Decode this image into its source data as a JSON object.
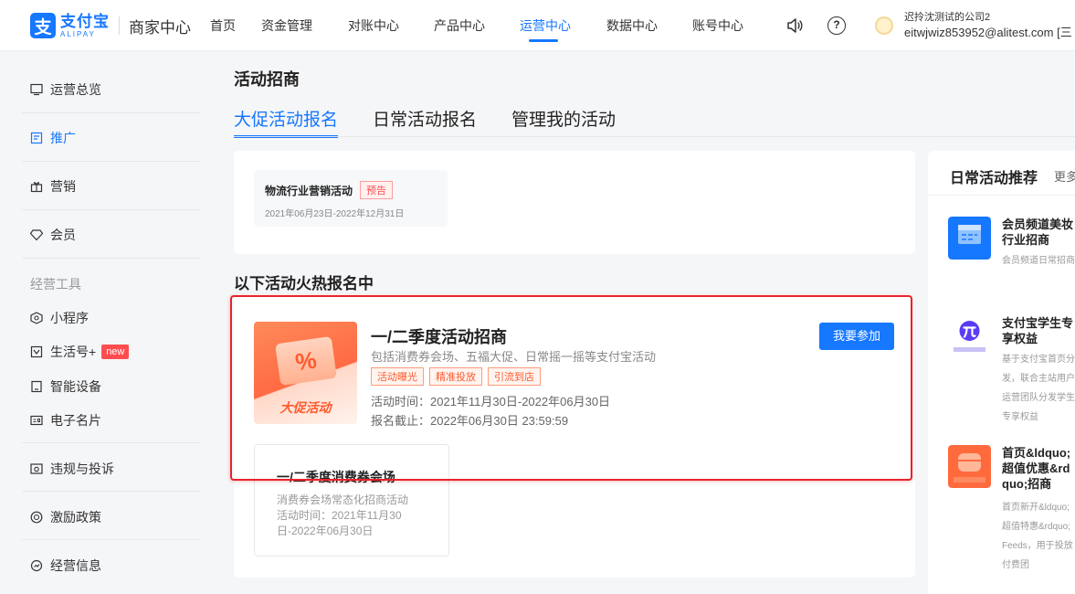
{
  "header": {
    "logo_cn": "支付宝",
    "logo_en": "ALIPAY",
    "center_label": "商家中心",
    "nav": [
      "首页",
      "资金管理",
      "对账中心",
      "产品中心",
      "运营中心",
      "数据中心",
      "账号中心"
    ],
    "active_nav": "运营中心",
    "account_name": "迟拎沈测试的公司2",
    "account_email": "eitwjwiz853952@alitest.com [三"
  },
  "sidebar": {
    "items_top": [
      "运营总览",
      "推广",
      "营销",
      "会员"
    ],
    "active": "推广",
    "group_label": "经营工具",
    "tools": [
      "小程序",
      "生活号+",
      "智能设备",
      "电子名片"
    ],
    "new_badge": "new",
    "items_bottom": [
      "违规与投诉",
      "激励政策",
      "经营信息"
    ]
  },
  "main": {
    "page_title": "活动招商",
    "tabs": [
      "大促活动报名",
      "日常活动报名",
      "管理我的活动"
    ],
    "preview": {
      "title": "物流行业营销活动",
      "tag": "预告",
      "date": "2021年06月23日-2022年12月31日"
    },
    "section_title": "以下活动火热报名中",
    "activity": {
      "image_symbol": "%",
      "image_label": "大促活动",
      "title": "一/二季度活动招商",
      "desc": "包括消费券会场、五福大促、日常摇一摇等支付宝活动",
      "tags": [
        "活动曝光",
        "精准投放",
        "引流到店"
      ],
      "time": "活动时间：2021年11月30日-2022年06月30日",
      "deadline": "报名截止：2022年06月30日 23:59:59",
      "join_label": "我要参加"
    },
    "sub_activity": {
      "title": "一/二季度消费券会场",
      "desc": "消费券会场常态化招商活动",
      "time": "活动时间：2021年11月30日-2022年06月30日"
    }
  },
  "right_panel": {
    "title": "日常活动推荐",
    "more": "更多",
    "items": [
      {
        "title": "会员频道美妆行业招商",
        "desc": "会员频道日常招商",
        "icon_color": "#1677ff"
      },
      {
        "title": "支付宝学生专享权益",
        "desc": "基于支付宝首页分发，联合主站用户运营团队分发学生专享权益",
        "icon_color": "#5b3cf5"
      },
      {
        "title": "首页&ldquo;超值优惠&rdquo;招商",
        "desc": "首页新开&ldquo;超值特惠&rdquo;Feeds，用于投放付费团",
        "icon_color": "#ff6a3d"
      }
    ]
  }
}
